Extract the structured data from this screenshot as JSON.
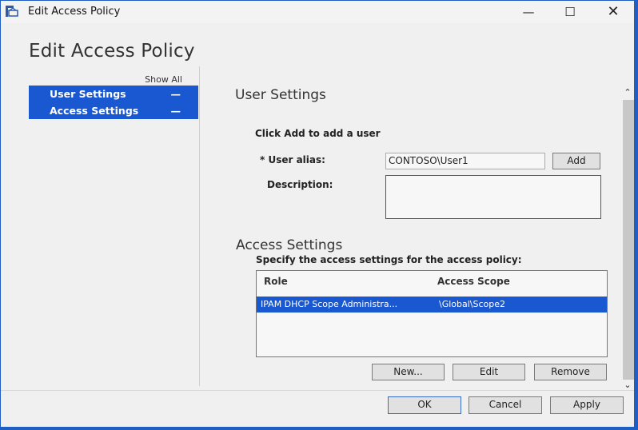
{
  "window": {
    "title": "Edit Access Policy",
    "controls": {
      "minimize": "—",
      "maximize": "☐",
      "close": "✕"
    }
  },
  "dialog": {
    "heading": "Edit Access Policy"
  },
  "nav": {
    "show_all": "Show All",
    "items": [
      {
        "label": "User Settings",
        "toggle": "—"
      },
      {
        "label": "Access Settings",
        "toggle": "—"
      }
    ]
  },
  "user_settings": {
    "title": "User Settings",
    "hint": "Click Add to add a user",
    "alias_label": "* User alias:",
    "alias_value": "CONTOSO\\User1",
    "add_label": "Add",
    "description_label": "Description:",
    "description_value": ""
  },
  "access_settings": {
    "title": "Access Settings",
    "hint": "Specify the access settings for the access policy:",
    "columns": [
      "Role",
      "Access Scope"
    ],
    "rows": [
      {
        "role": "IPAM DHCP Scope Administra...",
        "scope": "\\Global\\Scope2",
        "selected": true
      }
    ],
    "new_label": "New...",
    "edit_label": "Edit",
    "remove_label": "Remove"
  },
  "footer": {
    "ok": "OK",
    "cancel": "Cancel",
    "apply": "Apply"
  },
  "scrollbar": {
    "up": "⌃",
    "down": "⌄"
  }
}
